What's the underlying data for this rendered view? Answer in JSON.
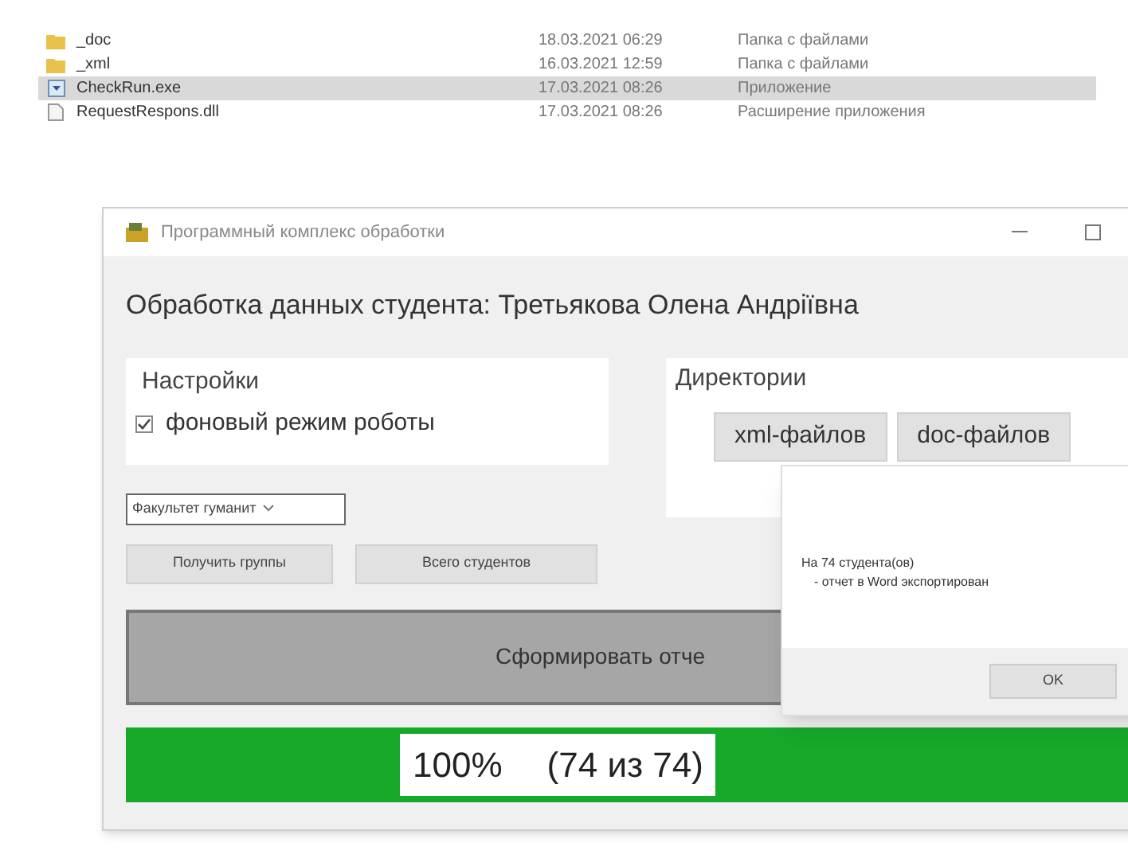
{
  "files": [
    {
      "name": "_doc",
      "date": "18.03.2021 06:29",
      "type": "Папка с файлами",
      "kind": "folder",
      "selected": false
    },
    {
      "name": "_xml",
      "date": "16.03.2021 12:59",
      "type": "Папка с файлами",
      "kind": "folder",
      "selected": false
    },
    {
      "name": "CheckRun.exe",
      "date": "17.03.2021 08:26",
      "type": "Приложение",
      "kind": "exe",
      "selected": true
    },
    {
      "name": "RequestRespons.dll",
      "date": "17.03.2021 08:26",
      "type": "Расширение приложения",
      "kind": "dll",
      "selected": false
    }
  ],
  "app": {
    "title": "Программный комплекс обработки",
    "heading": "Обработка данных студента: Третьякова Олена Андріївна",
    "settings": {
      "title": "Настройки",
      "options": [
        {
          "label": "фоновый режим роботы",
          "checked": true
        }
      ]
    },
    "directories": {
      "title": "Директории",
      "buttons": [
        "xml-файлов",
        "doc-файлов"
      ]
    },
    "faculty_select": {
      "value": "Факультет гуманит"
    },
    "buttons": [
      "Получить группы",
      "Всего студентов"
    ],
    "generate_button": "Сформировать отче",
    "progress": {
      "level": 1,
      "percent": "100%",
      "count": "(74 из 74)"
    }
  },
  "dialog": {
    "lines": [
      "На 74 студента(ов)",
      "- отчет в Word экспортирован"
    ],
    "ok_button": "OK"
  }
}
